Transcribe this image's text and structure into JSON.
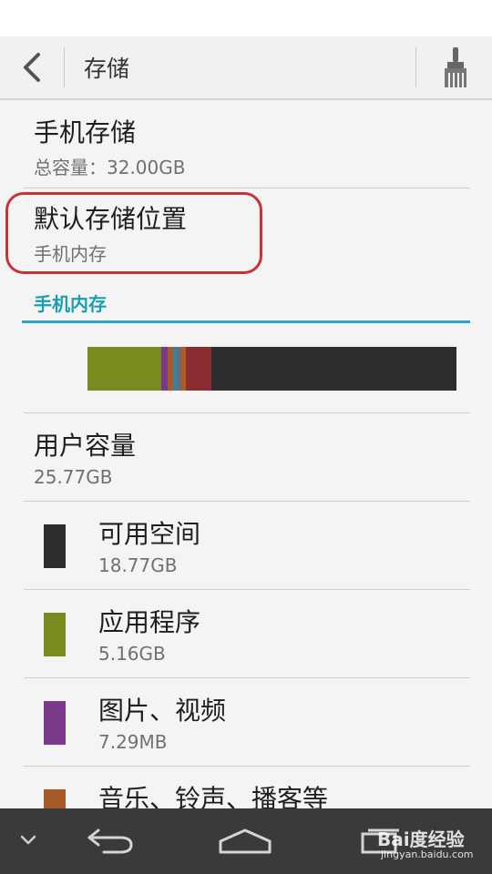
{
  "header": {
    "title": "存储"
  },
  "phone_storage": {
    "title": "手机存储",
    "subtitle": "总容量：32.00GB"
  },
  "default_location": {
    "title": "默认存储位置",
    "value": "手机内存"
  },
  "internal_section": {
    "header": "手机内存"
  },
  "usage_bar": {
    "segments": [
      {
        "name": "应用程序",
        "color": "#7b8a1e",
        "fraction": 0.2
      },
      {
        "name": "图片、视频",
        "color": "#7a3a8a",
        "fraction": 0.018
      },
      {
        "name": "音乐、铃声、播客等",
        "color": "#a65a28",
        "fraction": 0.015
      },
      {
        "name": "other-blue",
        "color": "#3d7fa3",
        "fraction": 0.012
      },
      {
        "name": "other-gray",
        "color": "#6a6a70",
        "fraction": 0.01
      },
      {
        "name": "other-orange",
        "color": "#b05a20",
        "fraction": 0.012
      },
      {
        "name": "other-red",
        "color": "#8a2c30",
        "fraction": 0.07
      },
      {
        "name": "可用空间",
        "color": "#2d2d2f",
        "fraction": 0.643
      }
    ]
  },
  "user_capacity": {
    "title": "用户容量",
    "value": "25.77GB"
  },
  "legend": [
    {
      "label": "可用空间",
      "value": "18.77GB",
      "color": "#2d2d2f"
    },
    {
      "label": "应用程序",
      "value": "5.16GB",
      "color": "#7b8a1e"
    },
    {
      "label": "图片、视频",
      "value": "7.29MB",
      "color": "#7a3a8a"
    },
    {
      "label": "音乐、铃声、播客等",
      "value": "",
      "color": "#a65a28"
    }
  ],
  "watermark": {
    "brand": "Bai度经验",
    "url": "jingyan.baidu.com"
  }
}
